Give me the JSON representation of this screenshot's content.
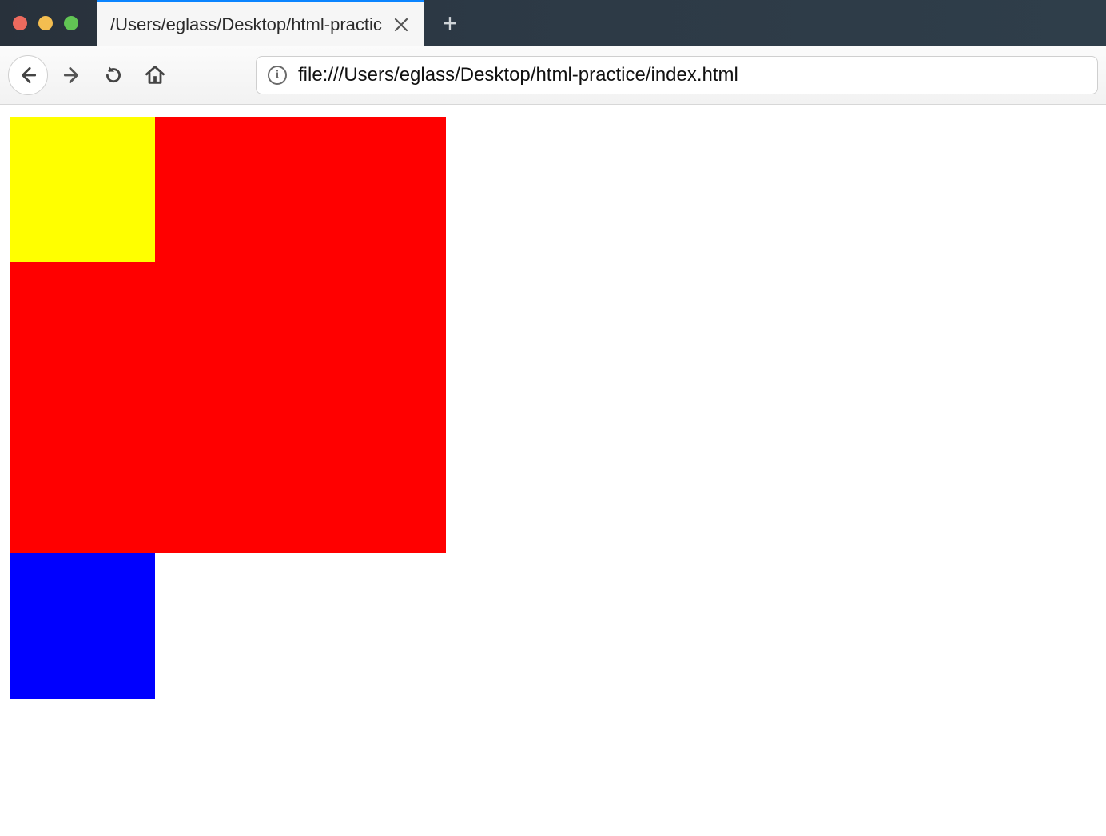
{
  "window": {
    "tab_title": "/Users/eglass/Desktop/html-practic",
    "new_tab_label": "+"
  },
  "toolbar": {
    "url": "file:///Users/eglass/Desktop/html-practice/index.html",
    "info_glyph": "i"
  },
  "page": {
    "boxes": {
      "red": {
        "color": "#ff0000"
      },
      "yellow": {
        "color": "#ffff00"
      },
      "blue": {
        "color": "#0000ff"
      }
    }
  }
}
